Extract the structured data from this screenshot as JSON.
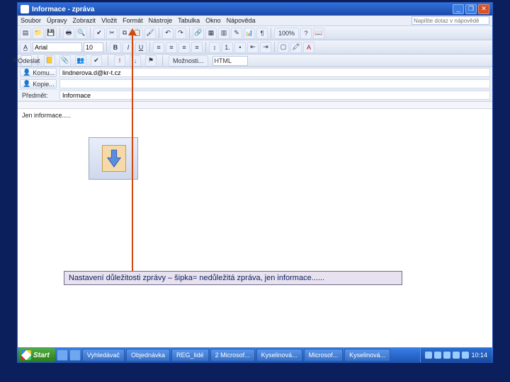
{
  "titlebar": {
    "app_icon": "✉",
    "title": "Informace - zpráva",
    "min": "_",
    "max": "❐",
    "close": "✕"
  },
  "menubar": {
    "items": [
      "Soubor",
      "Úpravy",
      "Zobrazit",
      "Vložit",
      "Formát",
      "Nástroje",
      "Tabulka",
      "Okno",
      "Nápověda"
    ],
    "question_placeholder": "Napište dotaz v nápovědě"
  },
  "toolbar1": {
    "zoom": "100%"
  },
  "toolbar2": {
    "font_name": "Arial",
    "font_size": "10"
  },
  "options_bar": {
    "send": "Odeslat",
    "options": "Možnosti...",
    "format": "HTML"
  },
  "headers": {
    "to_label": "Komu...",
    "to_value": "lindnerova.d@kr-t.cz",
    "cc_label": "Kopie...",
    "cc_value": "",
    "subject_label": "Předmět:",
    "subject_value": "Informace"
  },
  "body": {
    "text": "Jen informace....."
  },
  "caption": "Nastavení důležitosti zprávy – šipka= nedůležitá zpráva, jen informace......",
  "taskbar": {
    "start": "Start",
    "items": [
      "Vyhledávač",
      "Objednávka",
      "REG_lidé",
      "2 Microsof...",
      "Kyselinová...",
      "Microsof...",
      "Kyselinová..."
    ],
    "clock": "10:14"
  }
}
